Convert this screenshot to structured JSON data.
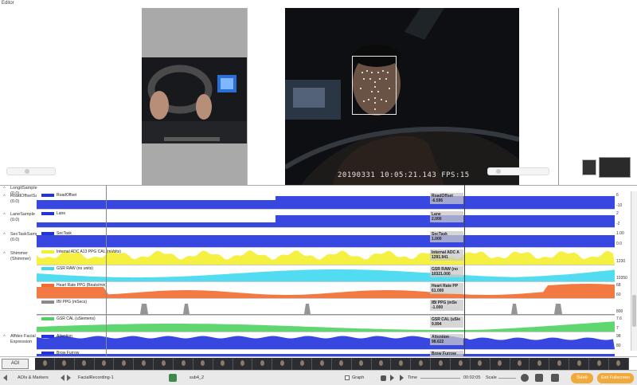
{
  "window": {
    "title": "Editor"
  },
  "video": {
    "timestamp_overlay": "20190331 10:05:21.143 FPS:15"
  },
  "signal_rows": [
    {
      "label": "LongitSample (0.0)",
      "legend": "",
      "value_title": "",
      "value": "",
      "axis_top": "",
      "axis_bottom": ""
    },
    {
      "label": "RoadOffsetSample (0.0)",
      "legend": "RoadOffset",
      "value_title": "RoadOffset",
      "value": "-6.595",
      "axis_top": "6",
      "axis_bottom": "-10"
    },
    {
      "label": "LaneSample (0.0)",
      "legend": "Lane",
      "value_title": "Lane",
      "value": "2.000",
      "axis_top": "2",
      "axis_bottom": "-2"
    },
    {
      "label": "SecTaskSample (0.0)",
      "legend": "SecTask",
      "value_title": "SecTask",
      "value": "1.000",
      "axis_top": "1.00",
      "axis_bottom": "0.0"
    },
    {
      "label": "Shimmer (Shimmer)",
      "legend": "Internal ADC A13 PPG CAL (mVolts)",
      "value_title": "Internal ADC A",
      "value": "1291.941",
      "axis_top": "",
      "axis_bottom": "1230"
    },
    {
      "label": "",
      "legend": "GSR RAW (no units)",
      "value_title": "GSR RAW (no",
      "value": "10321.000",
      "axis_top": "",
      "axis_bottom": "10350"
    },
    {
      "label": "",
      "legend": "Heart Rate PPG (Beats/min)",
      "value_title": "Heart Rate PP",
      "value": "61.000",
      "axis_top": "68",
      "axis_bottom": "60"
    },
    {
      "label": "",
      "legend": "IBI PPG (mSecs)",
      "value_title": "IBI PPG (mSe",
      "value": "-1.000",
      "axis_top": "",
      "axis_bottom": "800"
    },
    {
      "label": "",
      "legend": "GSR CAL (uSiemens)",
      "value_title": "GSR CAL (uSie",
      "value": "9.994",
      "axis_top": "7.6",
      "axis_bottom": "7"
    },
    {
      "label": "Affdex Facial Expression",
      "legend": "Attention",
      "value_title": "Attention",
      "value": "98.622",
      "axis_top": "98",
      "axis_bottom": "80"
    },
    {
      "label": "",
      "legend": "Brow Furrow",
      "value_title": "Brow Furrow",
      "value": "",
      "axis_top": "",
      "axis_bottom": ""
    }
  ],
  "colors": {
    "blue": "#2233dd",
    "yellow": "#f3ef2e",
    "cyan": "#3fd8ef",
    "orange": "#f26a2e",
    "gray": "#8a8a8a",
    "green": "#4fd160",
    "accent": "#f2a93b"
  },
  "filmstrip": {
    "aoi_label": "AOI"
  },
  "toolbar": {
    "aois_markers": "AOIs & Markers",
    "recording": "FacialRecording-1",
    "subject": "sub4_2",
    "graph_label": "Graph",
    "time_label": "Time",
    "time_value": "00:02:05",
    "scale_label": "Scale",
    "save_label": "Save",
    "fullscreen_label": "Exit Fullscreen"
  }
}
